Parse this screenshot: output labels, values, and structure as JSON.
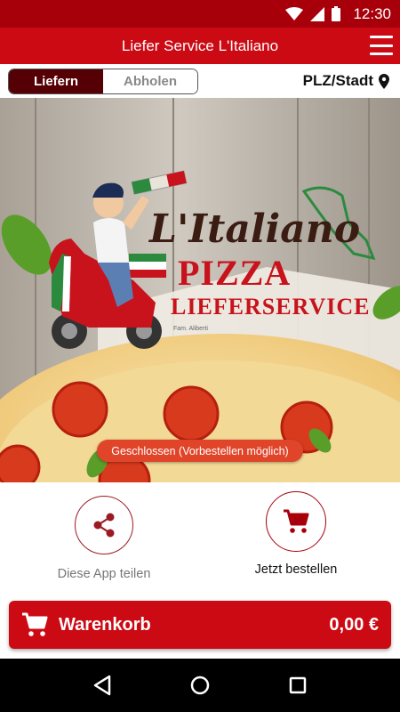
{
  "status_bar": {
    "time": "12:30"
  },
  "app_bar": {
    "title": "Liefer Service L'Italiano"
  },
  "mode_toggle": {
    "delivery": "Liefern",
    "pickup": "Abholen",
    "selected": "Liefern"
  },
  "location": {
    "label": "PLZ/Stadt"
  },
  "hero": {
    "brand_script": "L'Italiano",
    "brand_line1": "PIZZA",
    "brand_line2": "LIEFERSERVICE",
    "brand_owner": "Fam. Aliberti",
    "status": "Geschlossen (Vorbestellen möglich)"
  },
  "actions": {
    "share_label": "Diese App teilen",
    "order_label": "Jetzt bestellen"
  },
  "cart": {
    "label": "Warenkorb",
    "total": "0,00 €"
  },
  "colors": {
    "primary": "#cc0a14",
    "dark": "#540005",
    "status": "#e0452a"
  }
}
